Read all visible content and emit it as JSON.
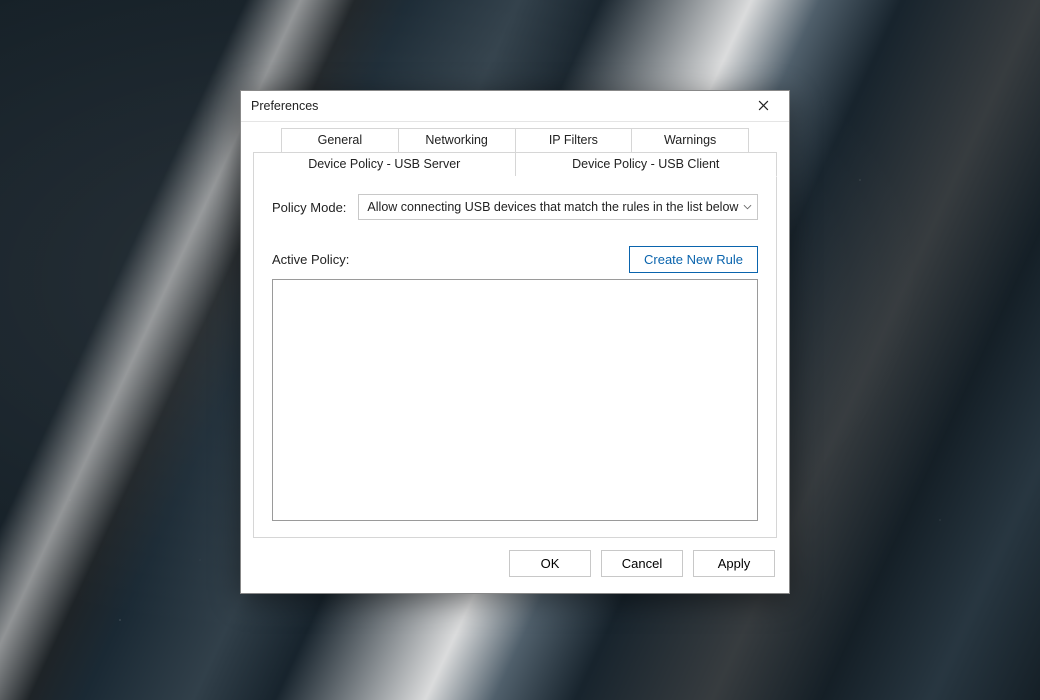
{
  "window": {
    "title": "Preferences"
  },
  "tabs": {
    "row1": [
      {
        "label": "General"
      },
      {
        "label": "Networking"
      },
      {
        "label": "IP Filters"
      },
      {
        "label": "Warnings"
      }
    ],
    "row2": [
      {
        "label": "Device Policy - USB Server"
      },
      {
        "label": "Device Policy - USB Client",
        "active": true
      }
    ]
  },
  "policy_mode": {
    "label": "Policy Mode:",
    "selected": "Allow connecting USB devices that match the rules in the list below"
  },
  "active_policy": {
    "label": "Active Policy:",
    "create_button": "Create New Rule"
  },
  "buttons": {
    "ok": "OK",
    "cancel": "Cancel",
    "apply": "Apply"
  }
}
